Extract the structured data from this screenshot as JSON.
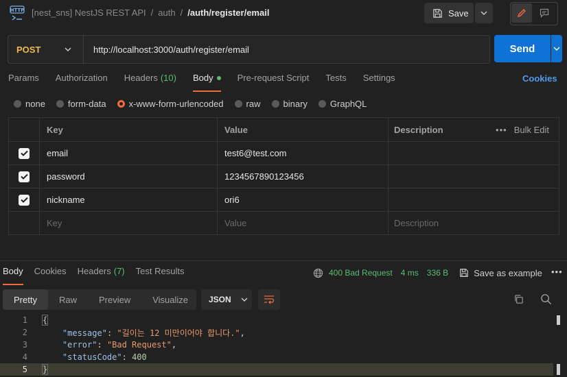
{
  "header": {
    "badge": "HTTP",
    "breadcrumb": [
      "[nest_sns] NestJS REST API",
      "auth"
    ],
    "current": "/auth/register/email",
    "save_label": "Save"
  },
  "request": {
    "method": "POST",
    "url": "http://localhost:3000/auth/register/email",
    "send_label": "Send"
  },
  "req_tabs": {
    "params": "Params",
    "authorization": "Authorization",
    "headers": "Headers",
    "headers_count": "(10)",
    "body": "Body",
    "pre_request": "Pre-request Script",
    "tests": "Tests",
    "settings": "Settings",
    "cookies": "Cookies"
  },
  "body_types": {
    "none": "none",
    "form_data": "form-data",
    "urlencoded": "x-www-form-urlencoded",
    "raw": "raw",
    "binary": "binary",
    "graphql": "GraphQL"
  },
  "table": {
    "headers": {
      "key": "Key",
      "value": "Value",
      "description": "Description",
      "bulk_edit": "Bulk Edit"
    },
    "rows": [
      {
        "key": "email",
        "value": "test6@test.com"
      },
      {
        "key": "password",
        "value": "1234567890123456"
      },
      {
        "key": "nickname",
        "value": "ori6"
      }
    ],
    "placeholders": {
      "key": "Key",
      "value": "Value",
      "description": "Description"
    }
  },
  "response": {
    "tabs": {
      "body": "Body",
      "cookies": "Cookies",
      "headers": "Headers",
      "headers_count": "(7)",
      "test_results": "Test Results"
    },
    "status": "400 Bad Request",
    "time": "4 ms",
    "size": "336 B",
    "save_example": "Save as example",
    "modes": [
      "Pretty",
      "Raw",
      "Preview",
      "Visualize"
    ],
    "format": "JSON",
    "lines": [
      {
        "n": "1",
        "brace": "{"
      },
      {
        "n": "2",
        "key": "\"message\"",
        "val": "\"길이는 12 미만이어야 합니다.\"",
        "tail": ","
      },
      {
        "n": "3",
        "key": "\"error\"",
        "val": "\"Bad Request\"",
        "tail": ","
      },
      {
        "n": "4",
        "key": "\"statusCode\"",
        "num": "400"
      },
      {
        "n": "5",
        "brace": "}"
      }
    ]
  },
  "colors": {
    "accent": "#f26b3a",
    "send": "#0f73d6",
    "status_ok": "#5bbd72",
    "method": "#f0b94e"
  }
}
